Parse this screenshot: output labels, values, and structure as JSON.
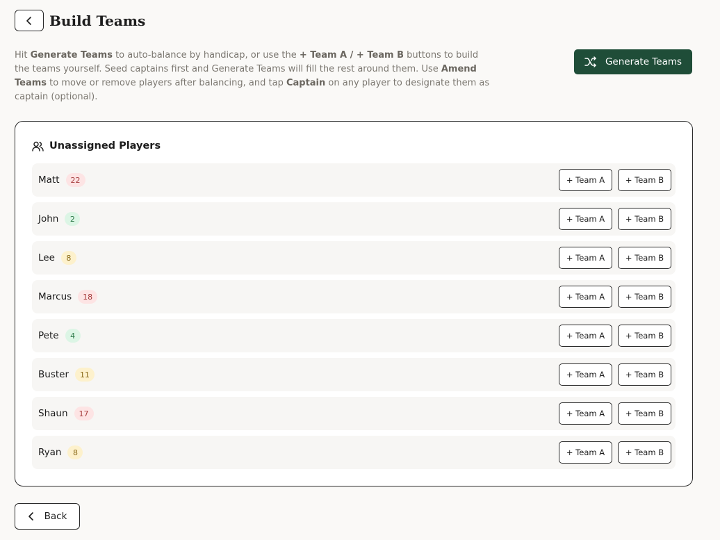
{
  "header": {
    "back_icon": "chevron-left-icon",
    "title": "Build Teams"
  },
  "intro": {
    "p1": "Hit ",
    "b1": "Generate Teams",
    "p2": " to auto-balance by handicap, or use the ",
    "b2": "+ Team A / + Team B",
    "p3": " buttons to build the teams yourself. Seed captains first and Generate Teams will fill the rest around them. Use ",
    "b3": "Amend Teams",
    "p4": " to move or remove players after balancing, and tap ",
    "b4": "Captain",
    "p5": " on any player to designate them as captain (optional)."
  },
  "generate": {
    "label": "Generate Teams",
    "icon": "shuffle-icon",
    "color": "#1f4d38"
  },
  "unassigned": {
    "title": "Unassigned Players",
    "icon": "users-icon",
    "players": [
      {
        "name": "Matt",
        "hcp": "22",
        "level": "high",
        "team_a": "+ Team A",
        "team_b": "+ Team B"
      },
      {
        "name": "John",
        "hcp": "2",
        "level": "low",
        "team_a": "+ Team A",
        "team_b": "+ Team B"
      },
      {
        "name": "Lee",
        "hcp": "8",
        "level": "mid",
        "team_a": "+ Team A",
        "team_b": "+ Team B"
      },
      {
        "name": "Marcus",
        "hcp": "18",
        "level": "high",
        "team_a": "+ Team A",
        "team_b": "+ Team B"
      },
      {
        "name": "Pete",
        "hcp": "4",
        "level": "low",
        "team_a": "+ Team A",
        "team_b": "+ Team B"
      },
      {
        "name": "Buster",
        "hcp": "11",
        "level": "mid",
        "team_a": "+ Team A",
        "team_b": "+ Team B"
      },
      {
        "name": "Shaun",
        "hcp": "17",
        "level": "high",
        "team_a": "+ Team A",
        "team_b": "+ Team B"
      },
      {
        "name": "Ryan",
        "hcp": "8",
        "level": "mid",
        "team_a": "+ Team A",
        "team_b": "+ Team B"
      }
    ]
  },
  "footer": {
    "back_label": "Back",
    "back_icon": "chevron-left-icon"
  },
  "colors": {
    "high": "#fde4e4",
    "low": "#dcf5e5",
    "mid": "#fdf1cc"
  }
}
